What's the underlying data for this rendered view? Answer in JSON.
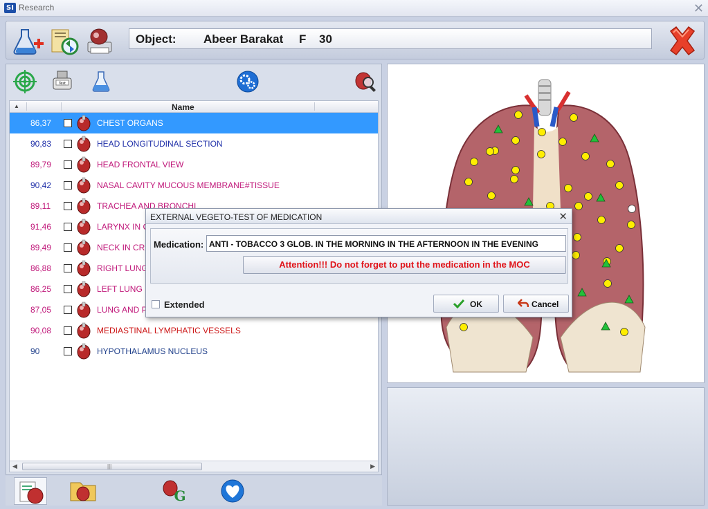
{
  "window": {
    "logo": "SI",
    "title": "Research",
    "close": "✕"
  },
  "toolbar": {
    "buttons": [
      "add-flask-icon",
      "refresh-folder-icon",
      "print-organ-icon"
    ],
    "object_label": "Object:",
    "object_name": "Abeer Barakat",
    "object_gender": "F",
    "object_age": "30"
  },
  "list": {
    "header_name": "Name",
    "rows": [
      {
        "value": "86,37",
        "name": "CHEST ORGANS",
        "color": "#ffffff",
        "selected": true
      },
      {
        "value": "90,83",
        "name": "HEAD LONGITUDINAL SECTION",
        "color": "#1f2fa8"
      },
      {
        "value": "89,79",
        "name": "HEAD FRONTAL VIEW",
        "color": "#c0187a"
      },
      {
        "value": "90,42",
        "name": "NASAL CAVITY MUCOUS MEMBRANE#TISSUE",
        "color": "#c0187a"
      },
      {
        "value": "89,11",
        "name": "TRACHEA AND BRONCHI",
        "color": "#c0187a"
      },
      {
        "value": "91,46",
        "name": " LARYNX IN CROSS SECTION",
        "color": "#c0187a"
      },
      {
        "value": "89,49",
        "name": "NECK IN CROSS SECTION",
        "color": "#c0187a"
      },
      {
        "value": "86,88",
        "name": "RIGHT LUNG",
        "color": "#c0187a"
      },
      {
        "value": "86,25",
        "name": "LEFT LUNG",
        "color": "#c0187a"
      },
      {
        "value": "87,05",
        "name": "LUNG AND PLEURA",
        "color": "#c0187a"
      },
      {
        "value": "90,08",
        "name": "MEDIASTINAL LYMPHATIC VESSELS",
        "color": "#cc1515"
      },
      {
        "value": "90",
        "name": "HYPOTHALAMUS NUCLEUS",
        "color": "#1f3f8a"
      }
    ],
    "value_colors": [
      "#ffffff",
      "#1f2fa8",
      "#c0187a",
      "#1f2fa8",
      "#c0187a",
      "#c0187a",
      "#c0187a",
      "#c0187a",
      "#c0187a",
      "#c0187a",
      "#c0187a",
      "#1f3f8a"
    ]
  },
  "dialog": {
    "title": "EXTERNAL VEGETO-TEST OF MEDICATION",
    "close": "✕",
    "medication_label": "Medication:",
    "medication_value": "ANTI - TOBACCO 3 GLOB. IN THE MORNING IN THE AFTERNOON IN THE EVENING",
    "attention": "Attention!!! Do not forget to put the medication in the MOC",
    "extended_label": "Extended",
    "ok_label": "OK",
    "cancel_label": "Cancel"
  },
  "colors": {
    "selection": "#3399ff",
    "attention_text": "#e0141a",
    "lung": "#b4646a"
  }
}
